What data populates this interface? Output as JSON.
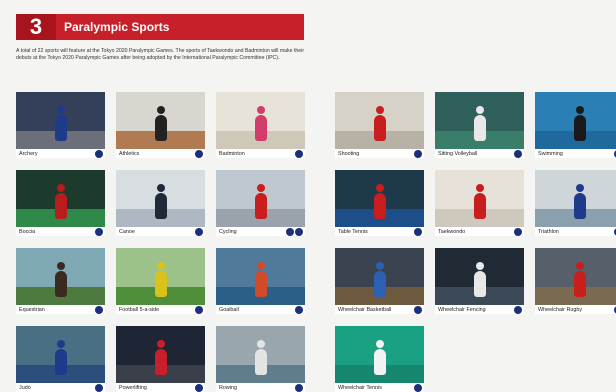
{
  "header": {
    "number": "3",
    "title": "Paralympic Sports"
  },
  "intro": "A total of 22 sports will feature at the Tokyo 2020 Paralympic Games. The sports of Taekwondo and Badminton will make their debuts at the Tokyo 2020 Paralympic Games after being adopted by the International Paralympic Committee (IPC).",
  "sports_left": [
    {
      "label": "Archery",
      "sky": "#34405a",
      "ground": "#6b6f7a",
      "athlete": "#1e3a8a"
    },
    {
      "label": "Athletics",
      "sky": "#d9d6cf",
      "ground": "#b07a52",
      "athlete": "#222"
    },
    {
      "label": "Badminton",
      "sky": "#e8e3d8",
      "ground": "#cfc8b8",
      "athlete": "#d13c6a"
    },
    {
      "label": "Boccia",
      "sky": "#1d3b2c",
      "ground": "#2f8a4a",
      "athlete": "#b91c1c"
    },
    {
      "label": "Canoe",
      "sky": "#d8dde2",
      "ground": "#aeb8c2",
      "athlete": "#1f2937"
    },
    {
      "label": "Cycling",
      "sky": "#bfc7cf",
      "ground": "#9aa3ab",
      "athlete": "#c81e1e"
    },
    {
      "label": "Equestrian",
      "sky": "#7fa9b5",
      "ground": "#4d7a3e",
      "athlete": "#3b2a20"
    },
    {
      "label": "Football 5-a-side",
      "sky": "#9cc28a",
      "ground": "#4f8f3c",
      "athlete": "#d9c21a"
    },
    {
      "label": "Goalball",
      "sky": "#4f7a9a",
      "ground": "#2c5f87",
      "athlete": "#d14a2a"
    },
    {
      "label": "Judo",
      "sky": "#4a6f85",
      "ground": "#2b4e7c",
      "athlete": "#1e3a8a"
    },
    {
      "label": "Powerlifting",
      "sky": "#1e2636",
      "ground": "#3a3f4a",
      "athlete": "#c71f2b"
    },
    {
      "label": "Rowing",
      "sky": "#9aa6ad",
      "ground": "#5f7d8c",
      "athlete": "#e3e3e3"
    }
  ],
  "sports_right": [
    {
      "label": "Shooting",
      "sky": "#d7d2c8",
      "ground": "#b8b2a6",
      "athlete": "#c81e1e"
    },
    {
      "label": "Sitting Volleyball",
      "sky": "#2f5f5a",
      "ground": "#3a7d6a",
      "athlete": "#e8e8e8"
    },
    {
      "label": "Swimming",
      "sky": "#2a7fb5",
      "ground": "#1f6a9c",
      "athlete": "#1a1a1a"
    },
    {
      "label": "Table Tennis",
      "sky": "#1e3a4a",
      "ground": "#1d4e89",
      "athlete": "#c81e1e"
    },
    {
      "label": "Taekwondo",
      "sky": "#e6e2da",
      "ground": "#cfc9bd",
      "athlete": "#c81e1e"
    },
    {
      "label": "Triathlon",
      "sky": "#cfd6da",
      "ground": "#8aa0ad",
      "athlete": "#1e3a8a"
    },
    {
      "label": "Wheelchair Basketball",
      "sky": "#3a4350",
      "ground": "#6d5a3f",
      "athlete": "#2d5fb3"
    },
    {
      "label": "Wheelchair Fencing",
      "sky": "#1f2a35",
      "ground": "#3c4a58",
      "athlete": "#e8e8e8"
    },
    {
      "label": "Wheelchair Rugby",
      "sky": "#57606a",
      "ground": "#7a6a52",
      "athlete": "#c81e1e"
    },
    {
      "label": "Wheelchair Tennis",
      "sky": "#1aa083",
      "ground": "#16866f",
      "athlete": "#f2f2f2"
    }
  ],
  "colors": {
    "brand_red": "#c8202a",
    "pictogram_blue": "#1b2f7a"
  }
}
